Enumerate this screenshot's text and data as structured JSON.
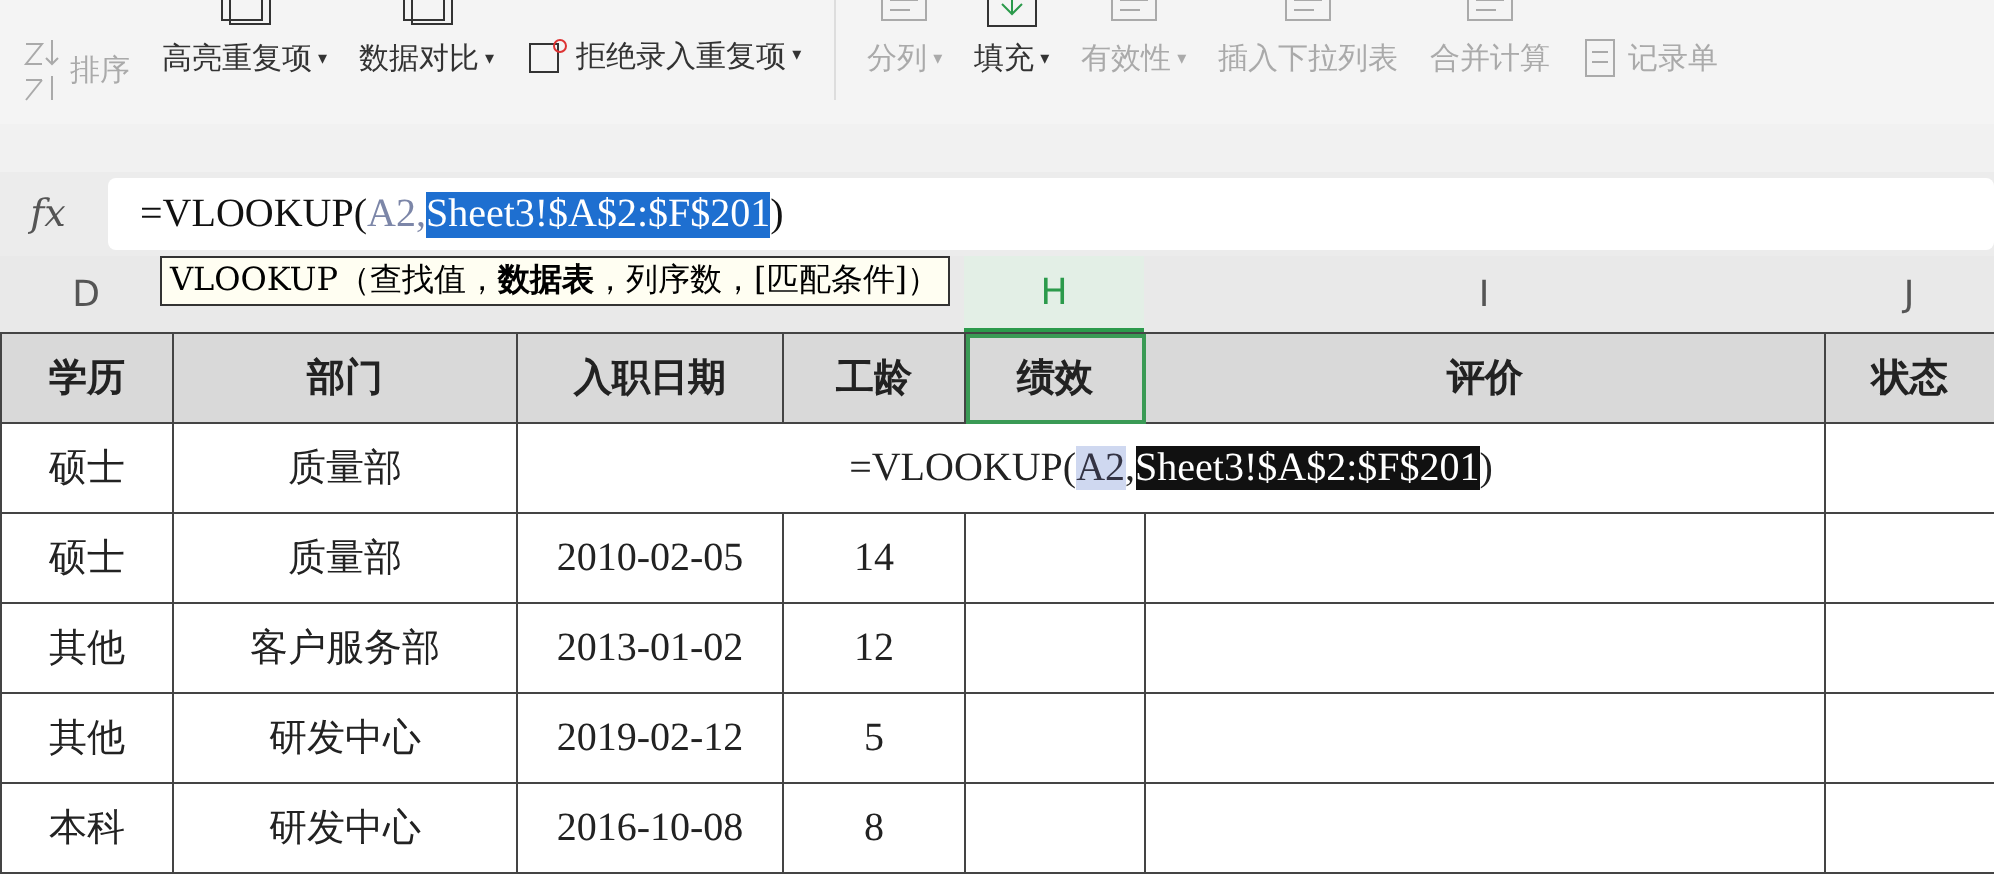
{
  "toolbar": {
    "items": [
      {
        "label": "排序",
        "kind": "sort",
        "disabled": true
      },
      {
        "label": "高亮重复项",
        "kind": "stack",
        "caret": "▾",
        "disabled": false
      },
      {
        "label": "数据对比",
        "kind": "stack",
        "caret": "▾",
        "disabled": false
      },
      {
        "label": "拒绝录入重复项",
        "kind": "inline",
        "caret": "▾",
        "disabled": false
      },
      {
        "label": "分列",
        "kind": "split",
        "caret": "▾",
        "disabled": true
      },
      {
        "label": "填充",
        "kind": "fill",
        "caret": "▾",
        "disabled": false
      },
      {
        "label": "有效性",
        "kind": "valid",
        "caret": "▾",
        "disabled": true
      },
      {
        "label": "插入下拉列表",
        "kind": "list",
        "disabled": true
      },
      {
        "label": "合并计算",
        "kind": "merge",
        "disabled": true
      },
      {
        "label": "记录单",
        "kind": "record",
        "disabled": true
      }
    ]
  },
  "formula_bar": {
    "label": "fx",
    "parts": [
      {
        "text": "=VLOOKUP(",
        "kind": "plain"
      },
      {
        "text": "A2,",
        "kind": "ref"
      },
      {
        "text": "Sheet3!$A$2:$F$201",
        "kind": "selected"
      },
      {
        "text": ")",
        "kind": "plain"
      }
    ]
  },
  "tooltip": "VLOOKUP（查找值，**数据表**，列序数，[匹配条件]）",
  "columns": [
    {
      "letter": "D",
      "header": "学历",
      "selected": false
    },
    {
      "header": "部门",
      "selected": false
    },
    {
      "header": "入职日期",
      "selected": false
    },
    {
      "header": "工龄",
      "selected": false
    },
    {
      "letter": "H",
      "header": "绩效",
      "selected": true
    },
    {
      "letter": "I",
      "header": "评价",
      "selected": false
    },
    {
      "letter": "J",
      "header": "状态",
      "selected": false
    }
  ],
  "rows": [
    {
      "cells": [
        "硕士",
        "质量部"
      ],
      "editor": [
        {
          "text": "=VLOOKUP(",
          "kind": "plain"
        },
        {
          "text": "A2",
          "kind": "ref"
        },
        {
          "text": ",",
          "kind": "plain"
        },
        {
          "text": "Sheet3!$A$2:$F$201",
          "kind": "selected"
        },
        {
          "text": ")",
          "kind": "plain"
        }
      ]
    },
    {
      "cells": [
        "硕士",
        "质量部",
        "2010-02-05",
        "14",
        "",
        "",
        ""
      ]
    },
    {
      "cells": [
        "其他",
        "客户服务部",
        "2013-01-02",
        "12",
        "",
        "",
        ""
      ]
    },
    {
      "cells": [
        "其他",
        "研发中心",
        "2019-02-12",
        "5",
        "",
        "",
        ""
      ]
    },
    {
      "cells": [
        "本科",
        "研发中心",
        "2016-10-08",
        "8",
        "",
        "",
        ""
      ]
    }
  ]
}
